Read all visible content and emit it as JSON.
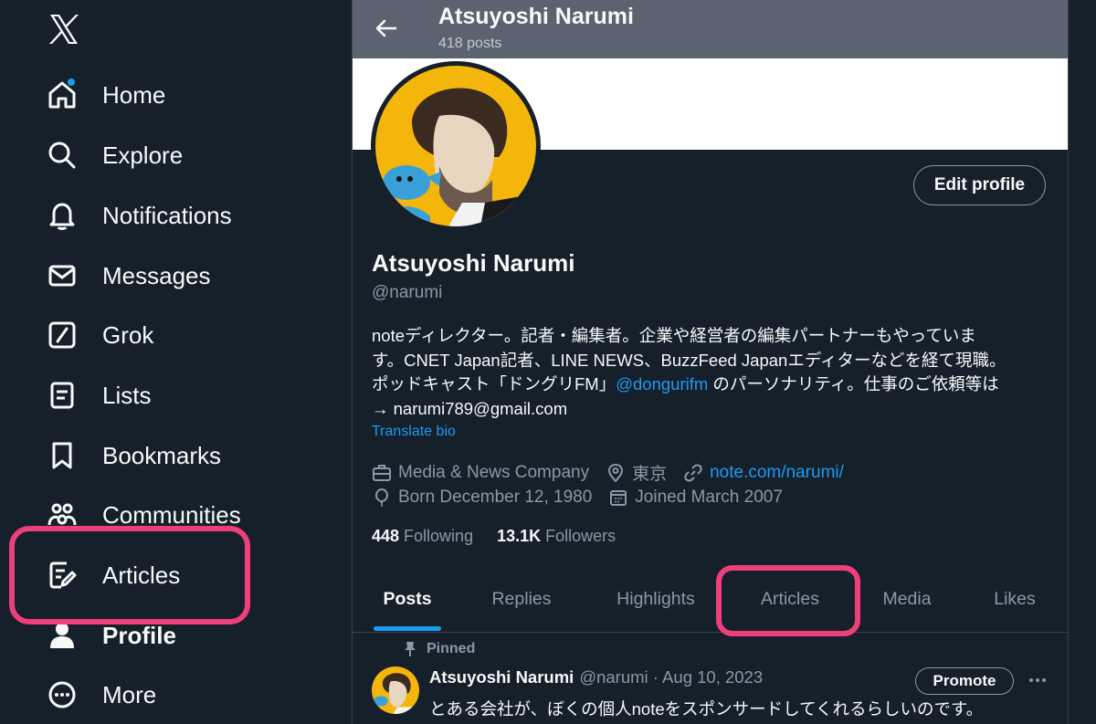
{
  "colors": {
    "background": "#15202b",
    "accent": "#1d9bf0",
    "highlight": "#ef3f7b",
    "muted": "#8b98a5"
  },
  "sidebar": {
    "logo": "x-logo-icon",
    "items": [
      {
        "label": "Home",
        "icon": "home-icon"
      },
      {
        "label": "Explore",
        "icon": "search-icon"
      },
      {
        "label": "Notifications",
        "icon": "bell-icon"
      },
      {
        "label": "Messages",
        "icon": "envelope-icon"
      },
      {
        "label": "Grok",
        "icon": "grok-icon"
      },
      {
        "label": "Lists",
        "icon": "list-icon"
      },
      {
        "label": "Bookmarks",
        "icon": "bookmark-icon"
      },
      {
        "label": "Communities",
        "icon": "communities-icon"
      },
      {
        "label": "Articles",
        "icon": "article-icon"
      },
      {
        "label": "Profile",
        "icon": "person-icon"
      },
      {
        "label": "More",
        "icon": "more-circle-icon"
      }
    ]
  },
  "header": {
    "title": "Atsuyoshi Narumi",
    "posts_count": "418 posts"
  },
  "profile": {
    "edit_label": "Edit profile",
    "name": "Atsuyoshi Narumi",
    "handle": "@narumi",
    "bio": {
      "line1": "noteディレクター。記者・編集者。企業や経営者の編集パートナーもやっていま",
      "line2": "す。CNET Japan記者、LINE NEWS、BuzzFeed Japanエディターなどを経て現職。",
      "line3_before": "ポッドキャスト「ドングリFM」",
      "line3_mention": "@dongurifm",
      "line3_after": " のパーソナリティ。仕事のご依頼等は",
      "line4": "→ narumi789@gmail.com"
    },
    "translate_label": "Translate bio",
    "category": "Media & News Company",
    "location": "東京",
    "website": "note.com/narumi/",
    "birthday": "Born December 12, 1980",
    "joined": "Joined March 2007",
    "following_count": "448",
    "following_label": "Following",
    "followers_count": "13.1K",
    "followers_label": "Followers"
  },
  "tabs": [
    "Posts",
    "Replies",
    "Highlights",
    "Articles",
    "Media",
    "Likes"
  ],
  "pinned_post": {
    "pinned_label": "Pinned",
    "author": "Atsuyoshi Narumi",
    "meta": "@narumi · Aug 10, 2023",
    "promote_label": "Promote",
    "text": "とある会社が、ぼくの個人noteをスポンサードしてくれるらしいのです。"
  }
}
